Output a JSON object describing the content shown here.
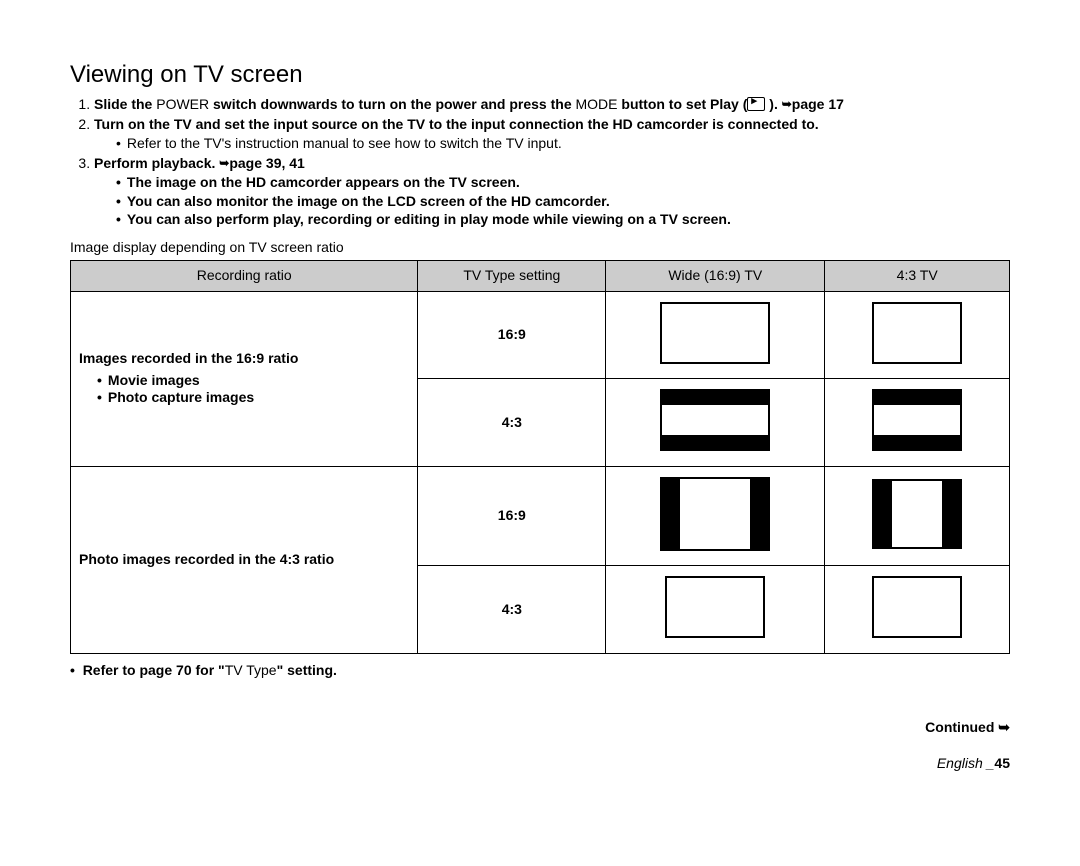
{
  "title": "Viewing on TV screen",
  "steps": {
    "s1a": "Slide the ",
    "s1b": "POWER",
    "s1c": " switch downwards to turn on the power and press the ",
    "s1d": "MODE",
    "s1e": " button to set Play (",
    "s1f": " ). ",
    "s1g": "page 17",
    "s2": "Turn on the TV and set the input source on the TV to the input connection the HD camcorder is connected to.",
    "s2a": "Refer to the TV's instruction manual to see how to switch the TV input.",
    "s3a": "Perform playback. ",
    "s3b": "page 39, 41",
    "s3c": "The image on the HD camcorder appears on the TV screen.",
    "s3d": "You can also monitor the image on the LCD screen of the HD camcorder.",
    "s3e": "You can also perform play, recording or editing in play mode while viewing on a TV screen."
  },
  "caption": "Image display depending on TV screen ratio",
  "headers": {
    "h1": "Recording ratio",
    "h2": "TV Type setting",
    "h3": "Wide (16:9) TV",
    "h4": "4:3 TV"
  },
  "rows": {
    "r1": {
      "label": "Images recorded in the 16:9 ratio",
      "b1": "Movie images",
      "b2": "Photo capture images"
    },
    "r2": {
      "label": "Photo images recorded in the 4:3 ratio"
    },
    "tv169": "16:9",
    "tv43": "4:3"
  },
  "footnote": {
    "a": "Refer to page 70 for \"",
    "b": "TV Type",
    "c": "\" setting."
  },
  "continued": "Continued ➥",
  "page": {
    "lang": "English _",
    "num": "45"
  }
}
